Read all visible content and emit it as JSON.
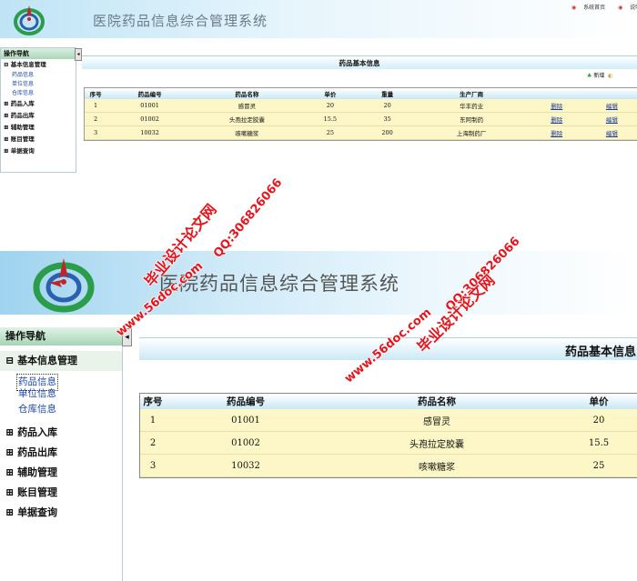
{
  "app": {
    "title": "医院药品信息综合管理系统",
    "top_links": [
      "系统首页",
      "说明"
    ]
  },
  "sidebar": {
    "heading": "操作导航",
    "groups": [
      {
        "label": "基本信息管理",
        "expander": "⊟",
        "items": [
          "药品信息",
          "单位信息",
          "仓库信息"
        ]
      },
      {
        "label": "药品入库",
        "expander": "⊞"
      },
      {
        "label": "药品出库",
        "expander": "⊞"
      },
      {
        "label": "辅助管理",
        "expander": "⊞"
      },
      {
        "label": "账目管理",
        "expander": "⊞"
      },
      {
        "label": "单据查询",
        "expander": "⊞"
      }
    ],
    "collapse_glyph": "◂"
  },
  "page": {
    "title": "药品基本信息",
    "title_cut": "药品基本信息",
    "add_label": "新增",
    "icons": [
      "add-icon",
      "back-icon"
    ]
  },
  "table": {
    "headers": [
      "序号",
      "药品编号",
      "药品名称",
      "单价",
      "重量",
      "生产厂商",
      "",
      ""
    ],
    "rows": [
      {
        "no": "1",
        "code": "01001",
        "name": "感冒灵",
        "price": "20",
        "weight": "20",
        "maker": "华丰药业",
        "del": "删除",
        "edit": "编辑"
      },
      {
        "no": "2",
        "code": "01002",
        "name": "头孢拉定胶囊",
        "price": "15.5",
        "weight": "35",
        "maker": "东阿制药",
        "del": "删除",
        "edit": "编辑"
      },
      {
        "no": "3",
        "code": "10032",
        "name": "咳嗽糖浆",
        "price": "25",
        "weight": "200",
        "maker": "上海制药厂",
        "del": "删除",
        "edit": "编辑"
      }
    ]
  },
  "watermark": {
    "site": "www.56doc.com",
    "qq": "QQ:306826066",
    "name": "毕业设计论文网"
  },
  "colors": {
    "watermark": "#e8141b",
    "header_blue": "#bfe4f6",
    "row_yellow": "#fdf7c7",
    "link_blue": "#1a47a8"
  }
}
